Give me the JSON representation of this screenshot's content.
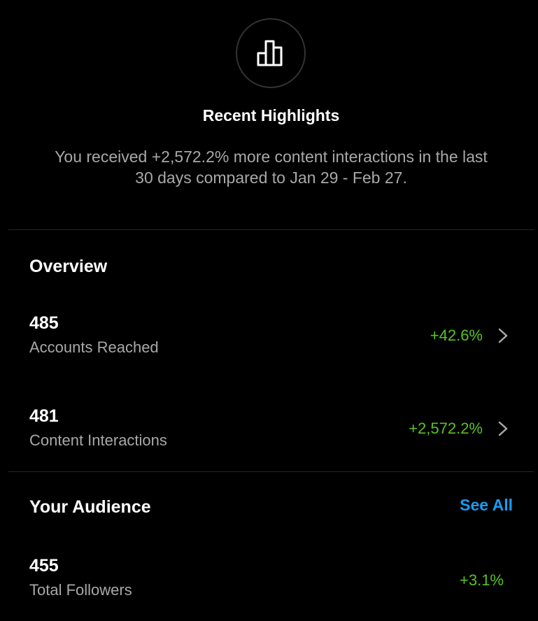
{
  "highlights": {
    "icon": "bar-chart-icon",
    "title": "Recent Highlights",
    "description": "You received +2,572.2% more content interactions in the last 30 days compared to Jan 29 - Feb 27."
  },
  "overview": {
    "title": "Overview",
    "rows": [
      {
        "value": "485",
        "label": "Accounts Reached",
        "change": "+42.6%"
      },
      {
        "value": "481",
        "label": "Content Interactions",
        "change": "+2,572.2%"
      }
    ]
  },
  "audience": {
    "title": "Your Audience",
    "see_all_label": "See All",
    "rows": [
      {
        "value": "455",
        "label": "Total Followers",
        "change": "+3.1%"
      }
    ]
  },
  "colors": {
    "background": "#000000",
    "positive_change": "#58c322",
    "link": "#1a9bf0",
    "secondary_text": "#a8a8a8"
  }
}
